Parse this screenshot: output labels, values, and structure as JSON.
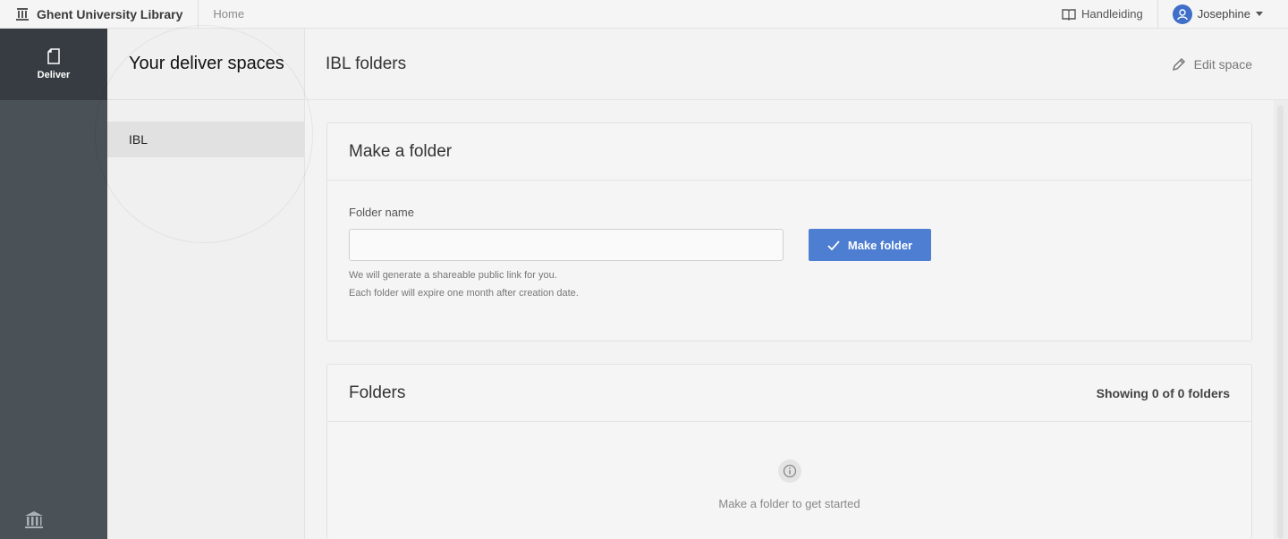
{
  "topbar": {
    "brand": "Ghent University Library",
    "home": "Home",
    "manual": "Handleiding",
    "user": "Josephine"
  },
  "rail": {
    "deliver": "Deliver"
  },
  "subnav": {
    "title": "Your deliver spaces",
    "items": [
      {
        "label": "IBL"
      }
    ]
  },
  "main": {
    "title": "IBL folders",
    "edit_space": "Edit space"
  },
  "make_folder": {
    "title": "Make a folder",
    "field_label": "Folder name",
    "input_value": "",
    "button": "Make folder",
    "help_line_1": "We will generate a shareable public link for you.",
    "help_line_2": "Each folder will expire one month after creation date."
  },
  "folders": {
    "title": "Folders",
    "count": "Showing 0 of 0 folders",
    "empty": "Make a folder to get started"
  },
  "colors": {
    "accent": "#4d7ed2",
    "rail": "#4a5157",
    "rail_active": "#363c41"
  }
}
